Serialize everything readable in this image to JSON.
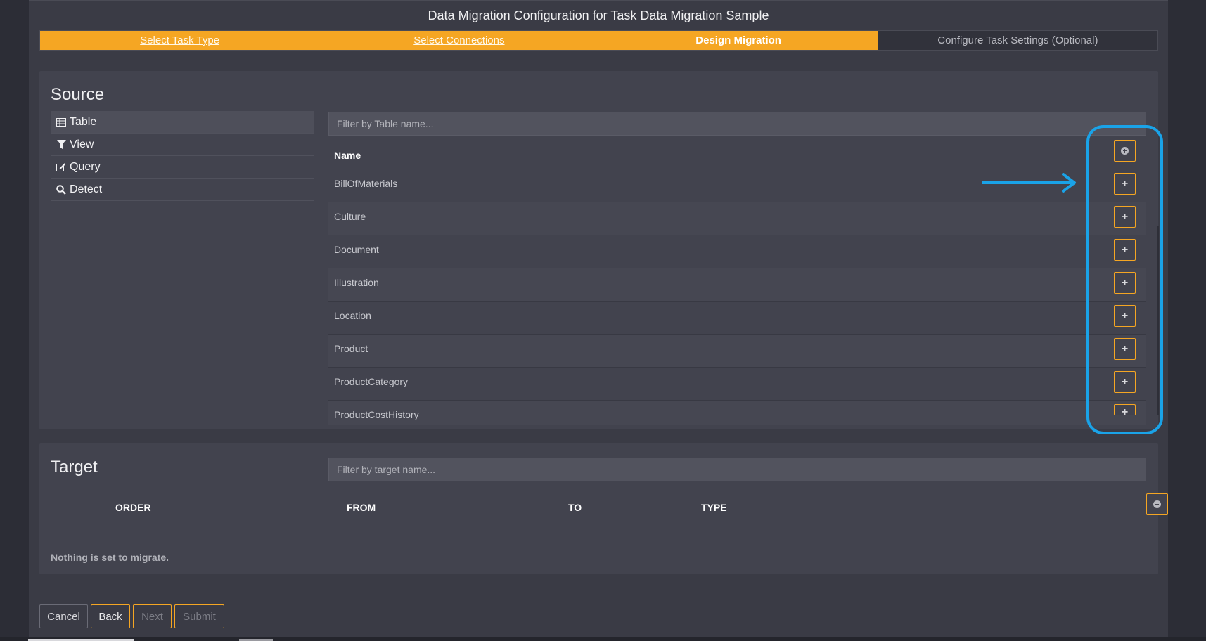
{
  "title": "Data Migration Configuration for Task Data Migration Sample",
  "wizard": {
    "steps": [
      {
        "label": "Select Task Type",
        "state": "link"
      },
      {
        "label": "Select Connections",
        "state": "link"
      },
      {
        "label": "Design Migration",
        "state": "current"
      },
      {
        "label": "Configure Task Settings (Optional)",
        "state": "todo"
      }
    ]
  },
  "source": {
    "heading": "Source",
    "sidebar": [
      {
        "label": "Table",
        "icon": "table-icon"
      },
      {
        "label": "View",
        "icon": "filter-icon"
      },
      {
        "label": "Query",
        "icon": "edit-icon"
      },
      {
        "label": "Detect",
        "icon": "search-icon"
      }
    ],
    "filter_placeholder": "Filter by Table name...",
    "column_name": "Name",
    "rows": [
      "BillOfMaterials",
      "Culture",
      "Document",
      "Illustration",
      "Location",
      "Product",
      "ProductCategory",
      "ProductCostHistory"
    ]
  },
  "target": {
    "heading": "Target",
    "filter_placeholder": "Filter by target name...",
    "columns": [
      "ORDER",
      "FROM",
      "TO",
      "TYPE"
    ],
    "empty_message": "Nothing is set to migrate."
  },
  "footer": {
    "cancel": "Cancel",
    "back": "Back",
    "next": "Next",
    "submit": "Submit"
  },
  "colors": {
    "accent": "#f5a623",
    "highlight": "#1aa3e8",
    "background": "#3a3b45"
  }
}
